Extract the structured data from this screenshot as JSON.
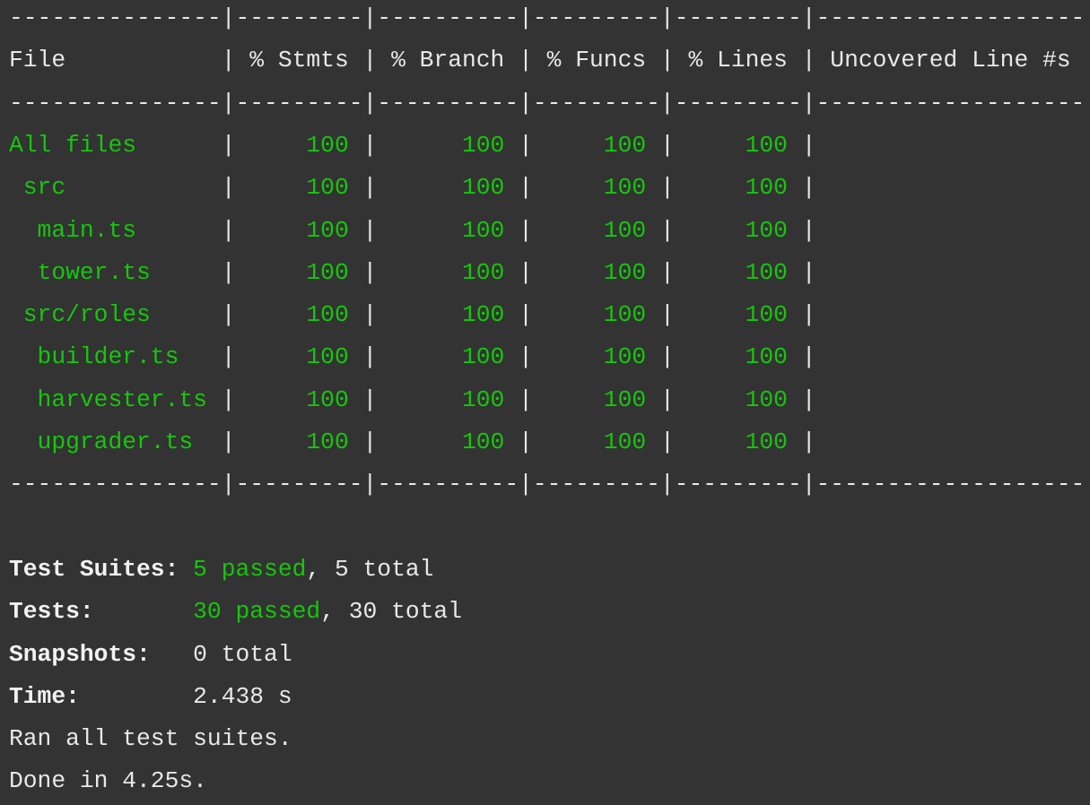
{
  "terminal": {
    "coverage_table": {
      "columns": [
        {
          "key": "file",
          "header": "File",
          "width": 15,
          "align": "left"
        },
        {
          "key": "stmts",
          "header": "% Stmts",
          "width": 9,
          "align": "right"
        },
        {
          "key": "branch",
          "header": "% Branch",
          "width": 10,
          "align": "right"
        },
        {
          "key": "funcs",
          "header": "% Funcs",
          "width": 9,
          "align": "right"
        },
        {
          "key": "lines",
          "header": "% Lines",
          "width": 9,
          "align": "right"
        },
        {
          "key": "uncovered",
          "header": "Uncovered Line #s",
          "width": 19,
          "align": "left"
        }
      ],
      "rows": [
        {
          "file": "All files",
          "indent": 0,
          "stmts": "100",
          "branch": "100",
          "funcs": "100",
          "lines": "100",
          "uncovered": ""
        },
        {
          "file": "src",
          "indent": 1,
          "stmts": "100",
          "branch": "100",
          "funcs": "100",
          "lines": "100",
          "uncovered": ""
        },
        {
          "file": "main.ts",
          "indent": 2,
          "stmts": "100",
          "branch": "100",
          "funcs": "100",
          "lines": "100",
          "uncovered": ""
        },
        {
          "file": "tower.ts",
          "indent": 2,
          "stmts": "100",
          "branch": "100",
          "funcs": "100",
          "lines": "100",
          "uncovered": ""
        },
        {
          "file": "src/roles",
          "indent": 1,
          "stmts": "100",
          "branch": "100",
          "funcs": "100",
          "lines": "100",
          "uncovered": ""
        },
        {
          "file": "builder.ts",
          "indent": 2,
          "stmts": "100",
          "branch": "100",
          "funcs": "100",
          "lines": "100",
          "uncovered": ""
        },
        {
          "file": "harvester.ts",
          "indent": 2,
          "stmts": "100",
          "branch": "100",
          "funcs": "100",
          "lines": "100",
          "uncovered": ""
        },
        {
          "file": "upgrader.ts",
          "indent": 2,
          "stmts": "100",
          "branch": "100",
          "funcs": "100",
          "lines": "100",
          "uncovered": ""
        }
      ]
    },
    "summary": [
      {
        "label": "Test Suites:",
        "passed": "5 passed",
        "rest": ", 5 total"
      },
      {
        "label": "Tests:",
        "passed": "30 passed",
        "rest": ", 30 total"
      },
      {
        "label": "Snapshots:",
        "passed": "",
        "rest": "0 total"
      },
      {
        "label": "Time:",
        "passed": "",
        "rest": "2.438 s"
      }
    ],
    "footer_lines": [
      "Ran all test suites.",
      "Done in 4.25s."
    ],
    "colors": {
      "background": "#333333",
      "text": "#e8e8e8",
      "pass_green": "#16c60c"
    }
  }
}
